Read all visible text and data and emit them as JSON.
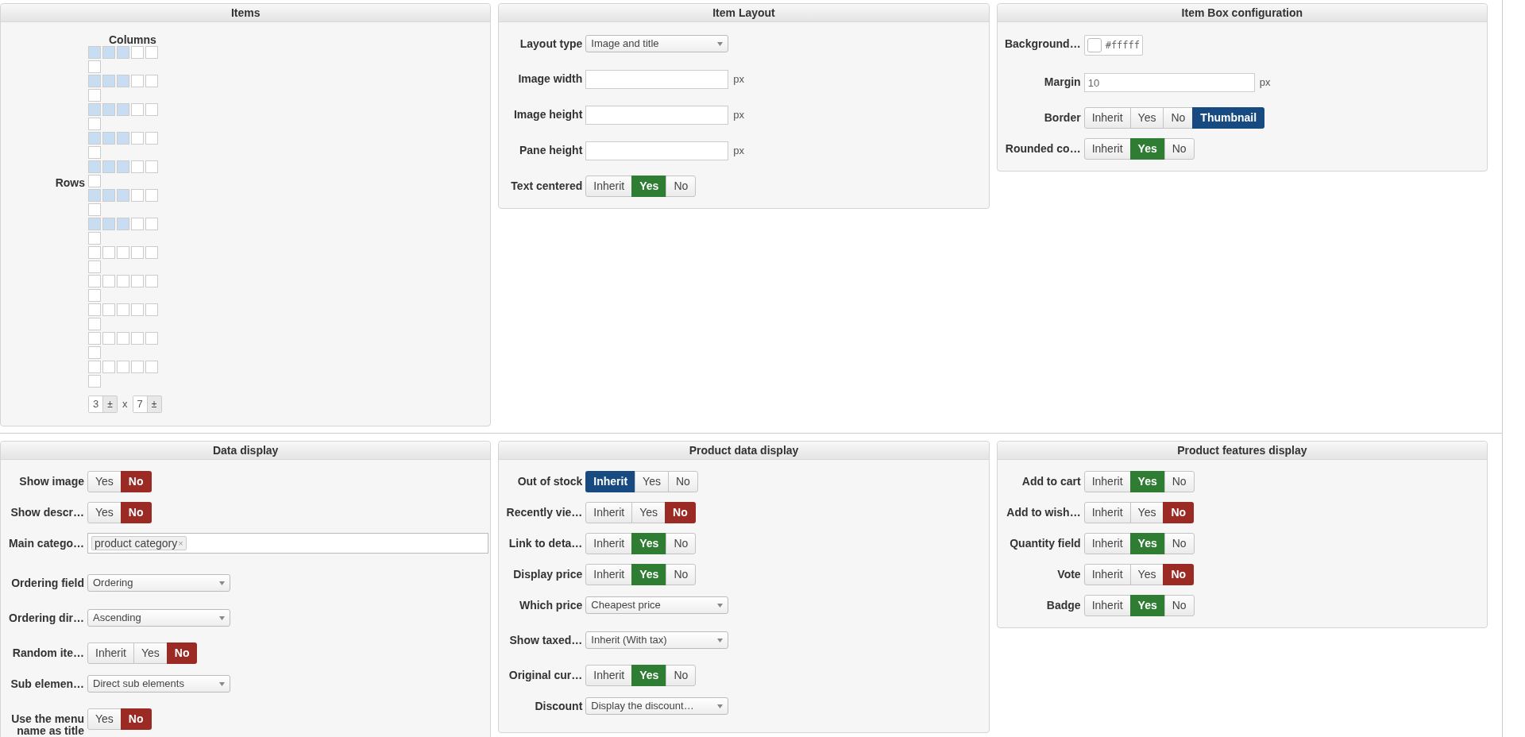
{
  "items": {
    "title": "Items",
    "columns_label": "Columns",
    "rows_label": "Rows",
    "grid": [
      {
        "cells": [
          {
            "selected": true
          },
          {
            "selected": true
          },
          {
            "selected": true
          },
          {
            "selected": false
          },
          {
            "selected": false
          }
        ],
        "extra": {
          "selected": false
        }
      },
      {
        "cells": [
          {
            "selected": true
          },
          {
            "selected": true
          },
          {
            "selected": true
          },
          {
            "selected": false
          },
          {
            "selected": false
          }
        ],
        "extra": {
          "selected": false
        }
      },
      {
        "cells": [
          {
            "selected": true
          },
          {
            "selected": true
          },
          {
            "selected": true
          },
          {
            "selected": false
          },
          {
            "selected": false
          }
        ],
        "extra": {
          "selected": false
        }
      },
      {
        "cells": [
          {
            "selected": true
          },
          {
            "selected": true
          },
          {
            "selected": true
          },
          {
            "selected": false
          },
          {
            "selected": false
          }
        ],
        "extra": {
          "selected": false
        }
      },
      {
        "cells": [
          {
            "selected": true
          },
          {
            "selected": true
          },
          {
            "selected": true
          },
          {
            "selected": false
          },
          {
            "selected": false
          }
        ],
        "extra": {
          "selected": false
        }
      },
      {
        "cells": [
          {
            "selected": true
          },
          {
            "selected": true
          },
          {
            "selected": true
          },
          {
            "selected": false
          },
          {
            "selected": false
          }
        ],
        "extra": {
          "selected": false
        }
      },
      {
        "cells": [
          {
            "selected": true
          },
          {
            "selected": true
          },
          {
            "selected": true
          },
          {
            "selected": false
          },
          {
            "selected": false
          }
        ],
        "extra": {
          "selected": false
        }
      },
      {
        "cells": [
          {
            "selected": false
          },
          {
            "selected": false
          },
          {
            "selected": false
          },
          {
            "selected": false
          },
          {
            "selected": false
          }
        ],
        "extra": {
          "selected": false
        }
      },
      {
        "cells": [
          {
            "selected": false
          },
          {
            "selected": false
          },
          {
            "selected": false
          },
          {
            "selected": false
          },
          {
            "selected": false
          }
        ],
        "extra": {
          "selected": false
        }
      },
      {
        "cells": [
          {
            "selected": false
          },
          {
            "selected": false
          },
          {
            "selected": false
          },
          {
            "selected": false
          },
          {
            "selected": false
          }
        ],
        "extra": {
          "selected": false
        }
      },
      {
        "cells": [
          {
            "selected": false
          },
          {
            "selected": false
          },
          {
            "selected": false
          },
          {
            "selected": false
          },
          {
            "selected": false
          }
        ],
        "extra": {
          "selected": false
        }
      },
      {
        "cells": [
          {
            "selected": false
          },
          {
            "selected": false
          },
          {
            "selected": false
          },
          {
            "selected": false
          },
          {
            "selected": false
          }
        ],
        "extra": {
          "selected": false
        }
      }
    ],
    "columns_value": "3",
    "rows_value": "7",
    "stepper": "±",
    "times": "x"
  },
  "item_layout": {
    "title": "Item Layout",
    "fields": [
      {
        "kind": "select",
        "label": "Layout type",
        "value": "Image and title"
      },
      {
        "kind": "text",
        "label": "Image width",
        "unit": "px"
      },
      {
        "kind": "text",
        "label": "Image height",
        "unit": "px"
      },
      {
        "kind": "text",
        "label": "Pane height",
        "unit": "px"
      },
      {
        "kind": "toggle",
        "label": "Text centered",
        "options": [
          {
            "label": "Inherit",
            "selected": false
          },
          {
            "label": "Yes",
            "selected": true,
            "color": "#2e7d32"
          },
          {
            "label": "No",
            "selected": false
          }
        ]
      }
    ]
  },
  "item_box": {
    "title": "Item Box configuration",
    "fields": [
      {
        "kind": "color",
        "label": "Background…",
        "color": "#ffffff",
        "value": "#fffff"
      },
      {
        "kind": "text",
        "label": "Margin",
        "value": "10",
        "unit": "px",
        "wide": true
      },
      {
        "kind": "toggle",
        "label": "Border",
        "options": [
          {
            "label": "Inherit",
            "selected": false
          },
          {
            "label": "Yes",
            "selected": false
          },
          {
            "label": "No",
            "selected": false
          },
          {
            "label": "Thumbnail",
            "selected": true,
            "color": "#164a80"
          }
        ]
      },
      {
        "kind": "toggle",
        "label": "Rounded co…",
        "options": [
          {
            "label": "Inherit",
            "selected": false
          },
          {
            "label": "Yes",
            "selected": true,
            "color": "#2e7d32"
          },
          {
            "label": "No",
            "selected": false
          }
        ]
      }
    ]
  },
  "data_display": {
    "title": "Data display",
    "fields": [
      {
        "kind": "toggle",
        "label": "Show image",
        "options": [
          {
            "label": "Yes",
            "selected": false
          },
          {
            "label": "No",
            "selected": true,
            "color": "#9b2a25"
          }
        ]
      },
      {
        "kind": "toggle",
        "label": "Show descr…",
        "options": [
          {
            "label": "Yes",
            "selected": false
          },
          {
            "label": "No",
            "selected": true,
            "color": "#9b2a25"
          }
        ]
      },
      {
        "kind": "tags",
        "label": "Main catego…",
        "tags": [
          {
            "label": "product category",
            "remove": "×"
          }
        ]
      },
      {
        "kind": "select",
        "label": "Ordering field",
        "value": "Ordering"
      },
      {
        "kind": "select",
        "label": "Ordering dir…",
        "value": "Ascending"
      },
      {
        "kind": "toggle",
        "label": "Random ite…",
        "options": [
          {
            "label": "Inherit",
            "selected": false
          },
          {
            "label": "Yes",
            "selected": false
          },
          {
            "label": "No",
            "selected": true,
            "color": "#9b2a25"
          }
        ]
      },
      {
        "kind": "select",
        "label": "Sub elemen…",
        "value": "Direct sub elements"
      },
      {
        "kind": "toggle",
        "label": "Use the menu name as title",
        "options": [
          {
            "label": "Yes",
            "selected": false
          },
          {
            "label": "No",
            "selected": true,
            "color": "#9b2a25"
          }
        ]
      }
    ]
  },
  "product_data_display": {
    "title": "Product data display",
    "fields": [
      {
        "kind": "toggle",
        "label": "Out of stock",
        "options": [
          {
            "label": "Inherit",
            "selected": true,
            "color": "#164a80"
          },
          {
            "label": "Yes",
            "selected": false
          },
          {
            "label": "No",
            "selected": false
          }
        ]
      },
      {
        "kind": "toggle",
        "label": "Recently vie…",
        "options": [
          {
            "label": "Inherit",
            "selected": false
          },
          {
            "label": "Yes",
            "selected": false
          },
          {
            "label": "No",
            "selected": true,
            "color": "#9b2a25"
          }
        ]
      },
      {
        "kind": "toggle",
        "label": "Link to deta…",
        "options": [
          {
            "label": "Inherit",
            "selected": false
          },
          {
            "label": "Yes",
            "selected": true,
            "color": "#2e7d32"
          },
          {
            "label": "No",
            "selected": false
          }
        ]
      },
      {
        "kind": "toggle",
        "label": "Display price",
        "options": [
          {
            "label": "Inherit",
            "selected": false
          },
          {
            "label": "Yes",
            "selected": true,
            "color": "#2e7d32"
          },
          {
            "label": "No",
            "selected": false
          }
        ]
      },
      {
        "kind": "select",
        "label": "Which price",
        "value": "Cheapest price"
      },
      {
        "kind": "select",
        "label": "Show taxed…",
        "value": "Inherit (With tax)"
      },
      {
        "kind": "toggle",
        "label": "Original cur…",
        "options": [
          {
            "label": "Inherit",
            "selected": false
          },
          {
            "label": "Yes",
            "selected": true,
            "color": "#2e7d32"
          },
          {
            "label": "No",
            "selected": false
          }
        ]
      },
      {
        "kind": "select",
        "label": "Discount",
        "value": "Display the discount…"
      }
    ]
  },
  "product_features_display": {
    "title": "Product features display",
    "fields": [
      {
        "kind": "toggle",
        "label": "Add to cart",
        "options": [
          {
            "label": "Inherit",
            "selected": false
          },
          {
            "label": "Yes",
            "selected": true,
            "color": "#2e7d32"
          },
          {
            "label": "No",
            "selected": false
          }
        ]
      },
      {
        "kind": "toggle",
        "label": "Add to wish…",
        "options": [
          {
            "label": "Inherit",
            "selected": false
          },
          {
            "label": "Yes",
            "selected": false
          },
          {
            "label": "No",
            "selected": true,
            "color": "#9b2a25"
          }
        ]
      },
      {
        "kind": "toggle",
        "label": "Quantity field",
        "options": [
          {
            "label": "Inherit",
            "selected": false
          },
          {
            "label": "Yes",
            "selected": true,
            "color": "#2e7d32"
          },
          {
            "label": "No",
            "selected": false
          }
        ]
      },
      {
        "kind": "toggle",
        "label": "Vote",
        "options": [
          {
            "label": "Inherit",
            "selected": false
          },
          {
            "label": "Yes",
            "selected": false
          },
          {
            "label": "No",
            "selected": true,
            "color": "#9b2a25"
          }
        ]
      },
      {
        "kind": "toggle",
        "label": "Badge",
        "options": [
          {
            "label": "Inherit",
            "selected": false
          },
          {
            "label": "Yes",
            "selected": true,
            "color": "#2e7d32"
          },
          {
            "label": "No",
            "selected": false
          }
        ]
      }
    ]
  }
}
